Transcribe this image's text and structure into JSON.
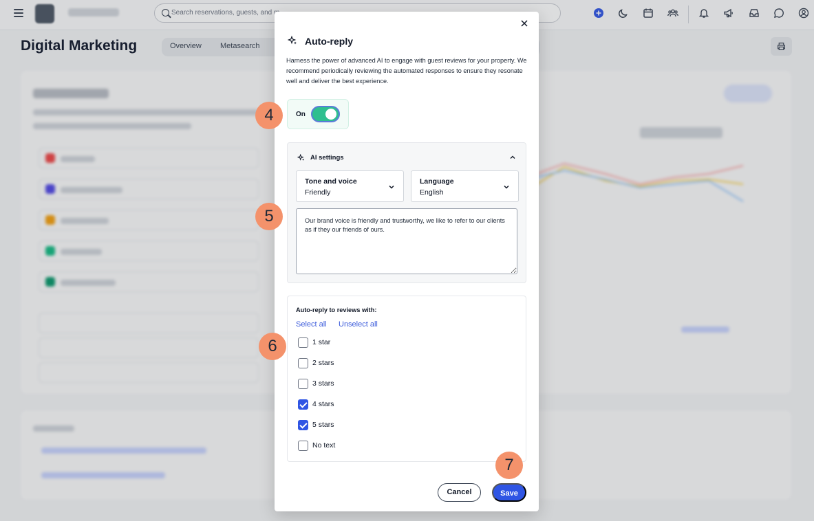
{
  "topbar": {
    "search_placeholder": "Search reservations, guests, and m",
    "icons": [
      "menu-icon",
      "plus-circle-icon",
      "moon-icon",
      "calendar-icon",
      "users-icon",
      "bell-icon",
      "megaphone-icon",
      "inbox-icon",
      "chat-icon",
      "account-icon"
    ]
  },
  "page": {
    "title": "Digital Marketing",
    "tabs": [
      {
        "label": "Overview"
      },
      {
        "label": "Metasearch"
      }
    ]
  },
  "modal": {
    "title": "Auto-reply",
    "description": "Harness the power of advanced AI to engage with guest reviews for your property. We recommend periodically reviewing the automated responses to ensure they resonate well and deliver the best experience.",
    "toggle": {
      "label": "On",
      "value": true
    },
    "ai_settings": {
      "title": "AI settings",
      "tone": {
        "label": "Tone and voice",
        "value": "Friendly"
      },
      "language": {
        "label": "Language",
        "value": "English"
      },
      "brand_voice": "Our brand voice is friendly and trustworthy, we like to refer to our clients as if they our friends of ours."
    },
    "reviews": {
      "title": "Auto-reply to reviews with:",
      "select_all": "Select all",
      "unselect_all": "Unselect all",
      "options": [
        {
          "label": "1 star",
          "checked": false
        },
        {
          "label": "2 stars",
          "checked": false
        },
        {
          "label": "3 stars",
          "checked": false
        },
        {
          "label": "4 stars",
          "checked": true
        },
        {
          "label": "5 stars",
          "checked": true
        },
        {
          "label": "No text",
          "checked": false
        }
      ]
    },
    "cancel_label": "Cancel",
    "save_label": "Save"
  },
  "steps": [
    "4",
    "5",
    "6",
    "7"
  ],
  "colors": {
    "primary": "#2f55e4",
    "toggle_on": "#2fbf8f",
    "step_marker": "#f4926b"
  }
}
